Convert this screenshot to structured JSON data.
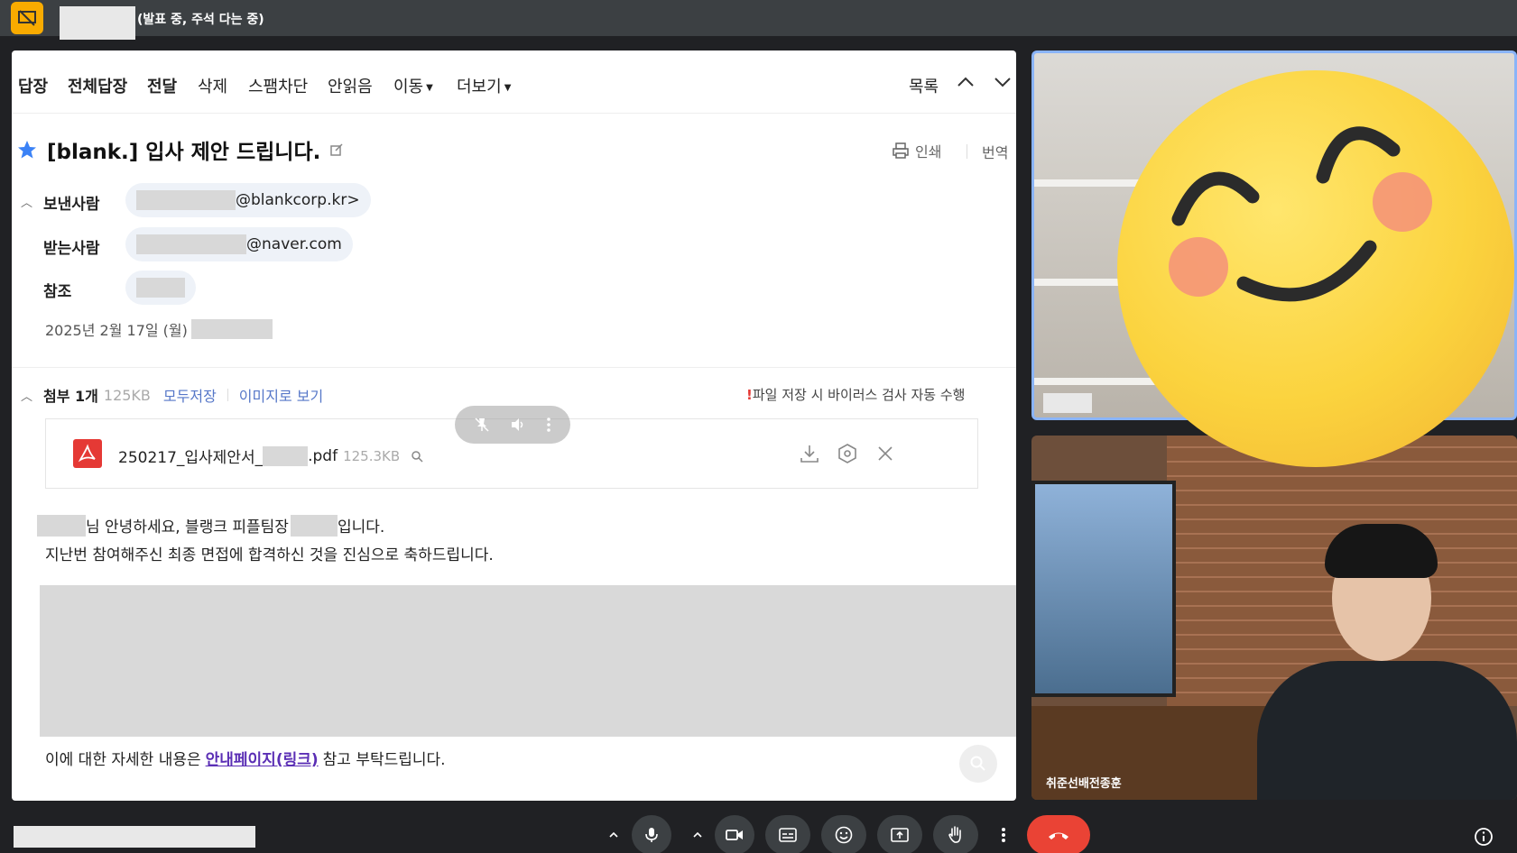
{
  "meeting": {
    "status": "(발표 중, 주석 다는 중)",
    "participant_name": "취준선배전종훈"
  },
  "toolbar": {
    "reply": "답장",
    "reply_all": "전체답장",
    "forward": "전달",
    "delete": "삭제",
    "spam": "스팸차단",
    "unread": "안읽음",
    "move": "이동",
    "more": "더보기",
    "list": "목록"
  },
  "email": {
    "subject": "[blank.] 입사 제안 드립니다.",
    "print": "인쇄",
    "translate": "번역",
    "sender_label": "보낸사람",
    "sender_value": "@blankcorp.kr>",
    "recipient_label": "받는사람",
    "recipient_value": "@naver.com",
    "cc_label": "참조",
    "date": "2025년 2월 17일 (월)",
    "attach_label": "첨부 1개",
    "attach_size": "125KB",
    "save_all": "모두저장",
    "view_image": "이미지로 보기",
    "virus_mark": "!",
    "virus_notice": "파일 저장 시 바이러스 검사 자동 수행",
    "file_name_prefix": "250217_입사제안서_",
    "file_name_ext": ".pdf",
    "file_size": "125.3KB",
    "greeting_part1": "님 안녕하세요, 블랭크 피플팀장",
    "greeting_part2": "입니다.",
    "line2": "지난번 참여해주신 최종 면접에 합격하신 것을 진심으로 축하드립니다.",
    "line3_before": "이에 대한 자세한 내용은",
    "line3_link": "안내페이지(링크)",
    "line3_after": "참고 부탁드립니다."
  },
  "colors": {
    "present_icon": "#f9ab00",
    "hangup": "#ea4335",
    "active_tile_border": "#8ab4f8",
    "link": "#5b2fb5",
    "star": "#3b82f6"
  }
}
